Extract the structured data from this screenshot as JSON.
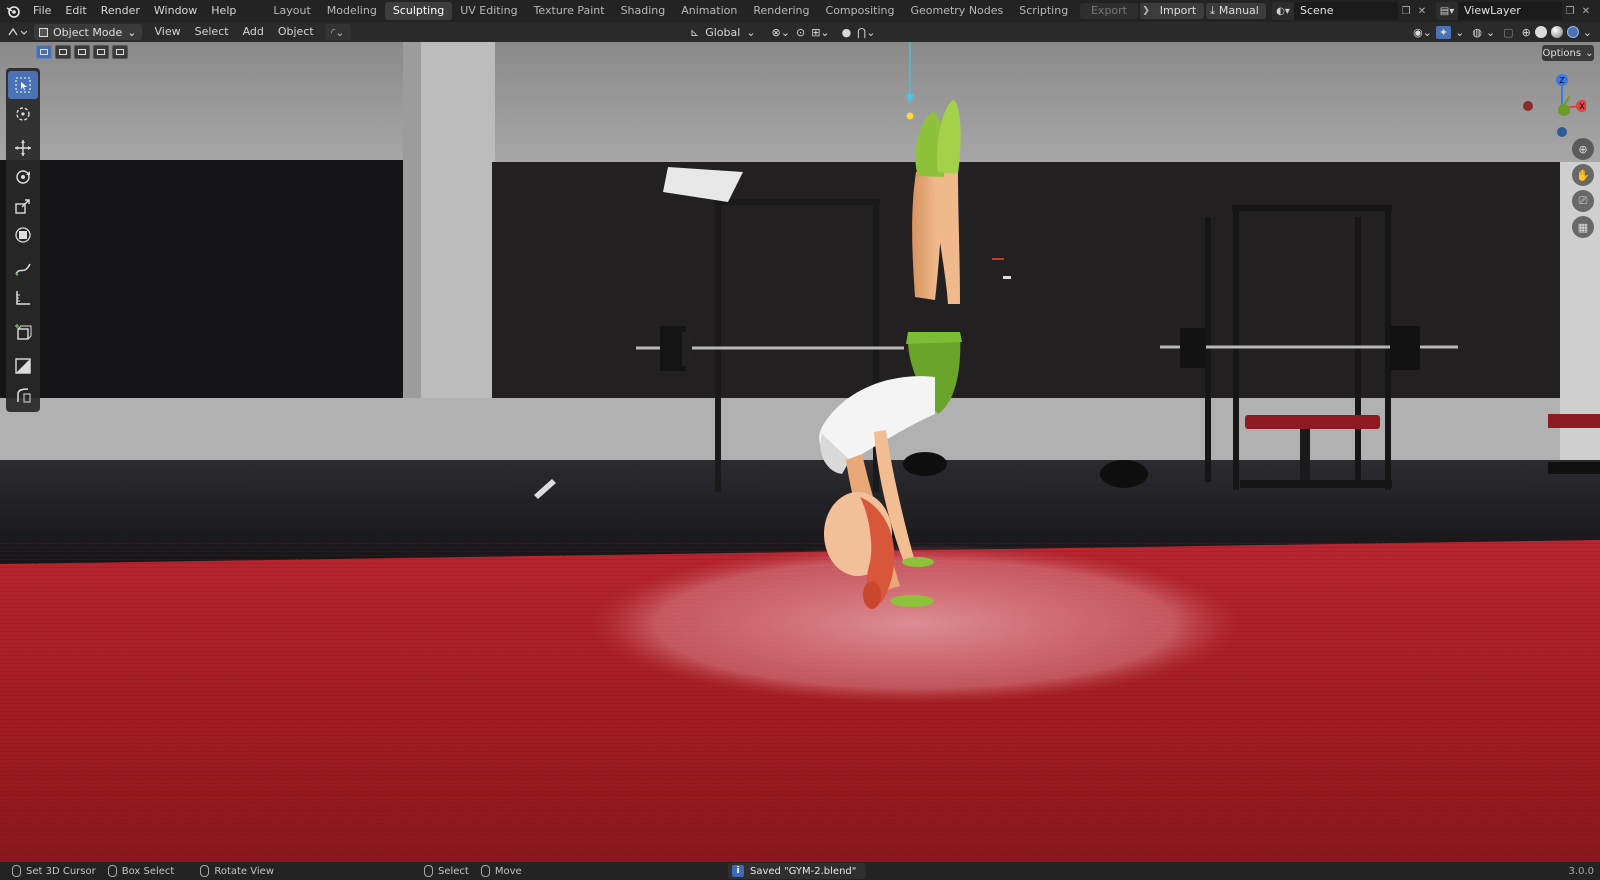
{
  "topbar": {
    "menu": [
      "File",
      "Edit",
      "Render",
      "Window",
      "Help"
    ],
    "workspaces": [
      "Layout",
      "Modeling",
      "Sculpting",
      "UV Editing",
      "Texture Paint",
      "Shading",
      "Animation",
      "Rendering",
      "Compositing",
      "Geometry Nodes",
      "Scripting"
    ],
    "active_workspace": "Sculpting",
    "add_label": "+",
    "export_label": "Export",
    "import_label": "Import",
    "manual_label": "Manual",
    "scene_name": "Scene",
    "view_layer_name": "ViewLayer"
  },
  "header": {
    "mode": "Object Mode",
    "menus": [
      "View",
      "Select",
      "Add",
      "Object"
    ],
    "orientation": "Global"
  },
  "viewport": {
    "options_label": "Options",
    "gizmo": {
      "z_label": "Z",
      "x_label": "X",
      "x_color": "#e5413e",
      "y_color": "#6a9c2a",
      "z_color": "#3b7ae0"
    }
  },
  "statusbar": {
    "items": [
      "Set 3D Cursor",
      "Box Select",
      "Rotate View",
      "Select",
      "Move"
    ],
    "saved_message": "Saved \"GYM-2.blend\"",
    "version": "3.0.0"
  },
  "colors": {
    "accent": "#4a72b5",
    "mat_red": "#b3202a",
    "shorts_green": "#6aa42a"
  }
}
